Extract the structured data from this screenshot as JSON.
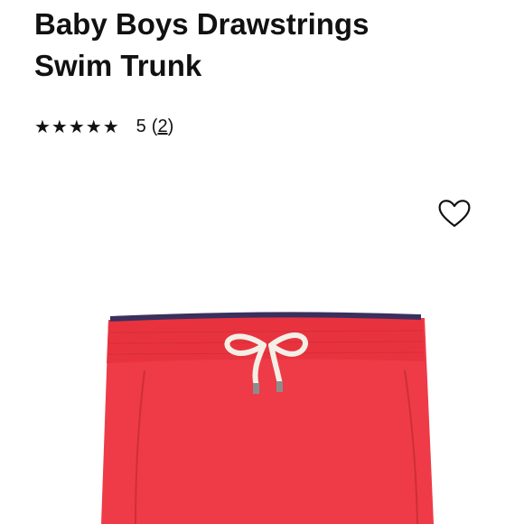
{
  "product": {
    "title_line1": "Baby Boys Drawstrings",
    "title_line2": "Swim Trunk",
    "stars": "★★★★★",
    "rating_value": "5",
    "review_open": "(",
    "review_count": "2",
    "review_close": ")",
    "star_rating": 5
  },
  "icons": {
    "wishlist": "heart-outline-icon"
  },
  "colors": {
    "trunk_red": "#ee3b47",
    "waistband_lining": "#3b2f5e",
    "drawstring": "#f3efe6",
    "text": "#111111"
  }
}
